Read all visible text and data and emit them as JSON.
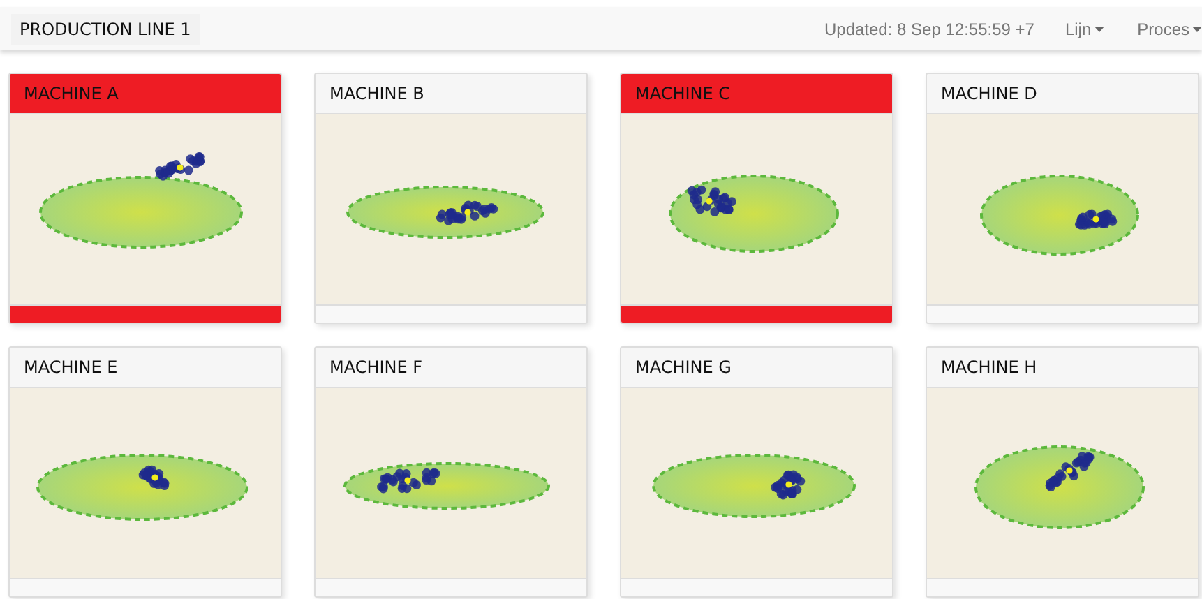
{
  "header": {
    "title": "PRODUCTION LINE 1",
    "updated": "Updated: 8 Sep 12:55:59 +7",
    "menus": [
      {
        "label": "Lijn"
      },
      {
        "label": "Proces"
      }
    ]
  },
  "machines": [
    {
      "name": "MACHINE A",
      "alarm": true
    },
    {
      "name": "MACHINE B",
      "alarm": false
    },
    {
      "name": "MACHINE C",
      "alarm": true
    },
    {
      "name": "MACHINE D",
      "alarm": false
    },
    {
      "name": "MACHINE E",
      "alarm": false
    },
    {
      "name": "MACHINE F",
      "alarm": false
    },
    {
      "name": "MACHINE G",
      "alarm": false
    },
    {
      "name": "MACHINE H",
      "alarm": false
    }
  ]
}
